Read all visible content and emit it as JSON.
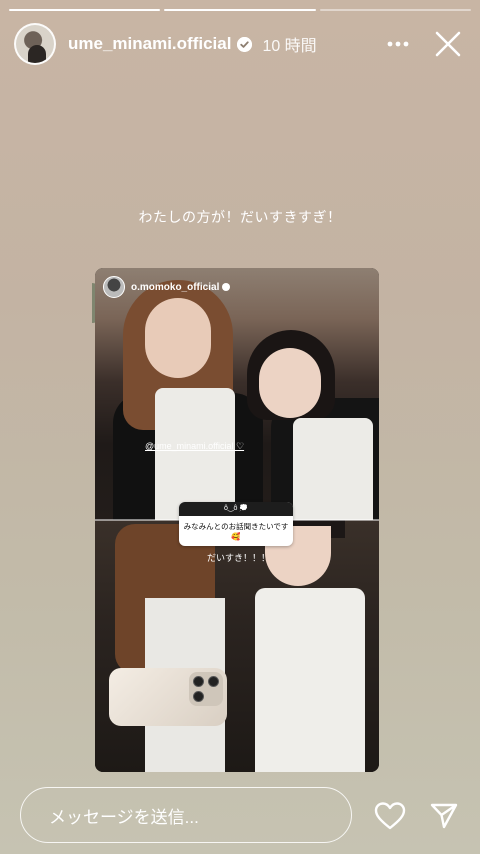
{
  "story": {
    "progress_fractions": [
      1.0,
      1.0,
      0.0
    ],
    "username": "ume_minami.official",
    "time": "10 時間",
    "caption": "わたしの方が！だいすきすぎ！"
  },
  "repost": {
    "username": "o.momoko_official",
    "mention": "@ume_minami.official ♡",
    "question_top": "ô‿ô 💭",
    "question_text": "みなみんとのお話聞きたいです🥰",
    "reply_text": "だいすき！！！"
  },
  "footer": {
    "message_placeholder": "メッセージを送信..."
  },
  "icons": {
    "verified": "verified-badge-icon",
    "more": "more-dots-icon",
    "close": "close-icon",
    "heart": "heart-icon",
    "send": "send-icon"
  }
}
